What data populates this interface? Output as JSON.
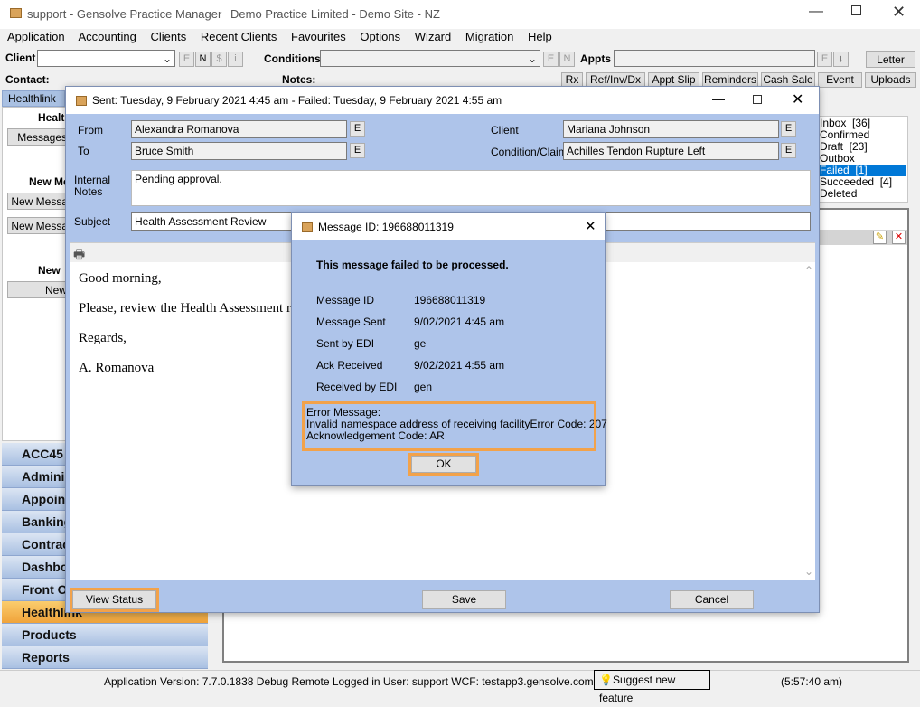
{
  "titlebar": {
    "app": "support - Gensolve Practice Manager",
    "practice": "Demo Practice Limited - Demo Site - NZ"
  },
  "menu": [
    "Application",
    "Accounting",
    "Clients",
    "Recent Clients",
    "Favourites",
    "Options",
    "Wizard",
    "Migration",
    "Help"
  ],
  "toolbar": {
    "client_label": "Client",
    "conditions_label": "Conditions",
    "appts_label": "Appts",
    "letter": "Letter",
    "contact_label": "Contact:",
    "notes_label": "Notes:",
    "small": {
      "e": "E",
      "n": "N",
      "s": "$",
      "i": "i"
    },
    "buttons": [
      "Rx",
      "Ref/Inv/Dx",
      "Appt Slip",
      "Reminders",
      "Cash Sale",
      "Event",
      "Uploads"
    ]
  },
  "healthlink_tab": "Healthlink",
  "left_panel": {
    "h1": "Healt",
    "messages": "Messages",
    "h2": "New Me",
    "new1": "New Messa",
    "new2": "New Messa",
    "h3": "New",
    "new3": "New"
  },
  "nav": [
    "ACC45",
    "Adminis",
    "Appoint",
    "Banking",
    "Contrac",
    "Dashbo",
    "Front O",
    "Healthlink",
    "Products",
    "Reports"
  ],
  "folders": [
    "Inbox  [36]",
    "Confirmed",
    "Draft  [23]",
    "Outbox",
    "Failed  [1]",
    "Succeeded  [4]",
    "Deleted"
  ],
  "msgwin": {
    "title": "Sent: Tuesday, 9 February 2021 4:45 am - Failed: Tuesday, 9 February 2021 4:55 am",
    "from_label": "From",
    "from": "Alexandra Romanova",
    "to_label": "To",
    "to": "Bruce Smith",
    "client_label": "Client",
    "client": "Mariana Johnson",
    "cond_label": "Condition/Claim",
    "cond": "Achilles Tendon Rupture Left",
    "notes_label1": "Internal",
    "notes_label2": "Notes",
    "notes": "Pending approval.",
    "subject_label": "Subject",
    "subject": "Health Assessment Review",
    "e": "E",
    "body": [
      "Good morning,",
      "Please, review the Health Assessment r",
      "Regards,",
      "A. Romanova"
    ],
    "view_status": "View Status",
    "save": "Save",
    "cancel": "Cancel"
  },
  "dialog": {
    "title": "Message ID: 196688011319",
    "heading": "This message failed to be processed.",
    "rows": [
      {
        "label": "Message ID",
        "value": "196688011319"
      },
      {
        "label": "Message Sent",
        "value": "9/02/2021 4:45 am"
      },
      {
        "label": "Sent by EDI",
        "value": "ge"
      },
      {
        "label": "Ack Received",
        "value": "9/02/2021 4:55 am"
      },
      {
        "label": "Received by EDI",
        "value": "gen"
      }
    ],
    "error_lines": [
      "Error Message:",
      "Invalid namespace address of receiving facilityError Code: 207",
      "Acknowledgement Code: AR"
    ],
    "ok": "OK"
  },
  "statusbar": {
    "version": "Application Version: 7.7.0.1838 Debug Remote  Logged in User: support WCF: testapp3.gensolve.com:4551",
    "suggest": "Suggest new feature",
    "time": "(5:57:40 am)"
  }
}
